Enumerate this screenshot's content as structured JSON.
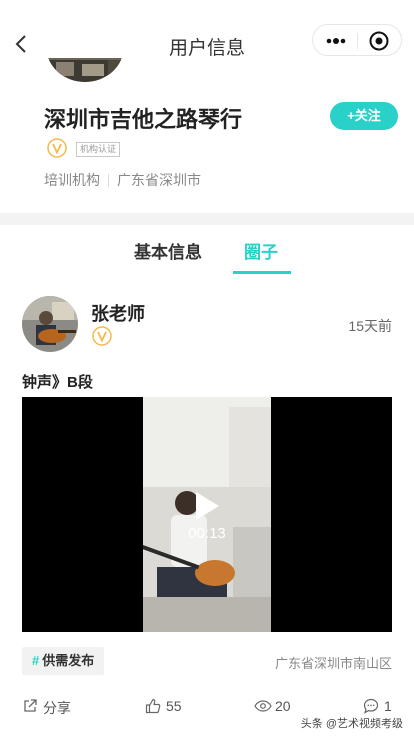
{
  "header": {
    "title": "用户信息",
    "back_icon": "chevron-left-icon",
    "more_icon": "more-dots-icon",
    "close_icon": "target-circle-icon"
  },
  "profile": {
    "name": "深圳市吉他之路琴行",
    "follow_label": "+关注",
    "verified_icon": "v-badge-icon",
    "cert_label": "机构认证",
    "category": "培训机构",
    "region": "广东省深圳市"
  },
  "tabs": [
    {
      "label": "基本信息",
      "active": false
    },
    {
      "label": "圈子",
      "active": true
    }
  ],
  "post": {
    "author": "张老师",
    "time": "15天前",
    "title": "钟声》B段",
    "duration": "00:13",
    "topic_hash": "#",
    "topic": "供需发布",
    "location": "广东省深圳市南山区",
    "share_label": "分享",
    "likes": "55",
    "views": "20",
    "comments": "1"
  },
  "watermark": "头条 @艺术视频考级",
  "colors": {
    "accent": "#2ad1c8",
    "badge": "#f5b94a"
  }
}
